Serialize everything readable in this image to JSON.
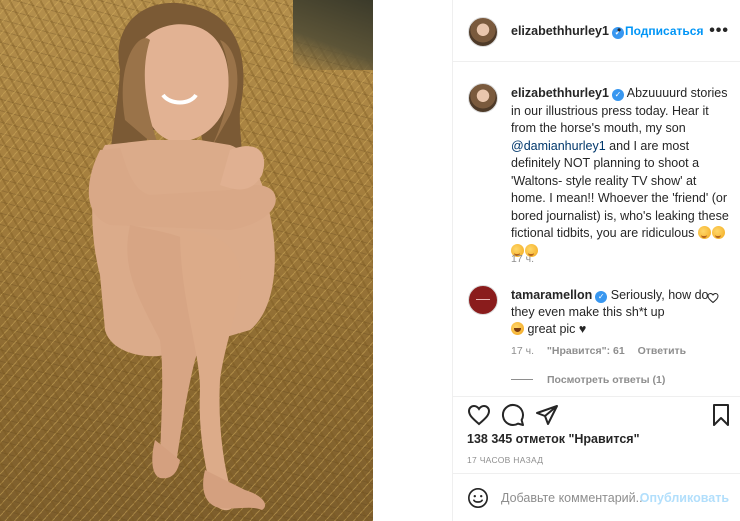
{
  "post": {
    "photo_alt": "",
    "author": "elizabethhurley1",
    "separator": "•",
    "follow_label": "Подписаться",
    "more_label": "•••"
  },
  "caption": {
    "username": "elizabethhurley1",
    "text_before_mention": "Abzuuuurd stories in our illustrious press today. Hear it from the horse's mouth, my son ",
    "mention": "@damianhurley1",
    "text_after_mention": " and I are most definitely NOT planning to shoot a 'Waltons- style reality TV show' at home. I mean!! Whoever the 'friend' (or bored journalist) is, who's leaking these fictional tidbits, you are ridiculous ",
    "time": "17 ч."
  },
  "comment": {
    "username": "tamaramellon",
    "text": "Seriously, how do they even make this sh*t up",
    "text_tail": "great pic ♥",
    "time": "17 ч.",
    "likes": "\"Нравится\": 61",
    "reply_label": "Ответить",
    "view_replies": "Посмотреть ответы (1)"
  },
  "actions": {
    "like_icon": "heart-icon",
    "comment_icon": "comment-icon",
    "share_icon": "paper-plane-icon",
    "save_icon": "bookmark-icon",
    "likes_count": "138 345 отметок \"Нравится\"",
    "posted_ago": "17 ЧАСОВ НАЗАД"
  },
  "add_comment": {
    "placeholder": "Добавьте комментарий...",
    "publish_label": "Опубликовать"
  },
  "colors": {
    "link": "#0095f6",
    "verified": "#3897f0",
    "muted": "#8e8e8e",
    "publish_disabled": "#b2dffc"
  }
}
